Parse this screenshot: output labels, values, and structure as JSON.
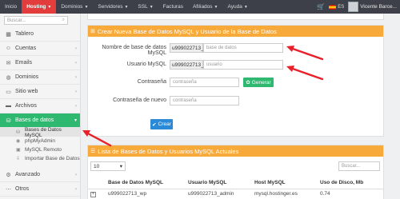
{
  "topnav": {
    "items": [
      {
        "label": "Inicio"
      },
      {
        "label": "Hosting"
      },
      {
        "label": "Dominios"
      },
      {
        "label": "Servidores"
      },
      {
        "label": "SSL"
      },
      {
        "label": "Facturas"
      },
      {
        "label": "Afiliados"
      },
      {
        "label": "Ayuda"
      }
    ],
    "language": "ES",
    "user_name": "Vicente Barce..."
  },
  "sidebar": {
    "search_placeholder": "Buscar...",
    "items": [
      {
        "label": "Tablero",
        "icon": "dashboard-icon"
      },
      {
        "label": "Cuentas",
        "icon": "user-icon"
      },
      {
        "label": "Emails",
        "icon": "envelope-icon"
      },
      {
        "label": "Dominios",
        "icon": "globe-icon"
      },
      {
        "label": "Sitio web",
        "icon": "window-icon"
      },
      {
        "label": "Archivos",
        "icon": "folder-icon"
      },
      {
        "label": "Bases de datos",
        "icon": "database-icon"
      }
    ],
    "sub_items": [
      {
        "label": "Bases de Datos MySQL",
        "icon": "database-icon"
      },
      {
        "label": "phpMyAdmin",
        "icon": "php-icon"
      },
      {
        "label": "MySQL Remoto",
        "icon": "monitor-icon"
      },
      {
        "label": "Importar Base de Datos",
        "icon": "import-icon"
      }
    ],
    "bottom_items": [
      {
        "label": "Avanzado",
        "icon": "gear-icon"
      },
      {
        "label": "Otros",
        "icon": "dots-icon"
      }
    ]
  },
  "create_panel": {
    "title": "Crear Nueva Base de Datos MySQL y Usuario de la Base de Datos",
    "db_name_label": "Nombre de base de datos MySQL",
    "db_name_prefix": "u999022713_",
    "db_name_placeholder": "base de datos",
    "user_label": "Usuario MySQL",
    "user_prefix": "u999022713_",
    "user_placeholder": "usuario",
    "password_label": "Contraseña",
    "password_placeholder": "contraseña",
    "generate_label": "Generar",
    "password_again_label": "Contraseña de nuevo",
    "password_again_placeholder": "contraseña",
    "create_label": "Crear"
  },
  "list_panel": {
    "title": "Lista de Bases de Datos y Usuarios MySQL Actuales",
    "page_size": "10",
    "search_placeholder": "Buscar...",
    "columns": [
      "Base de Datos MySQL",
      "Usuario MySQL",
      "Host MySQL",
      "Uso de Disco, Mb"
    ],
    "rows": [
      {
        "database": "u999022713_wp",
        "user": "u999022713_admin",
        "host": "mysql.hostinger.es",
        "disk": "0.74"
      }
    ]
  },
  "colors": {
    "topnav_bg": "#3d4049",
    "active_tab": "#e23c3c",
    "sidebar_active": "#2fb870",
    "panel_header": "#f7a93a",
    "create_button": "#2b8ad7",
    "annotation_arrow": "#e8202a"
  }
}
